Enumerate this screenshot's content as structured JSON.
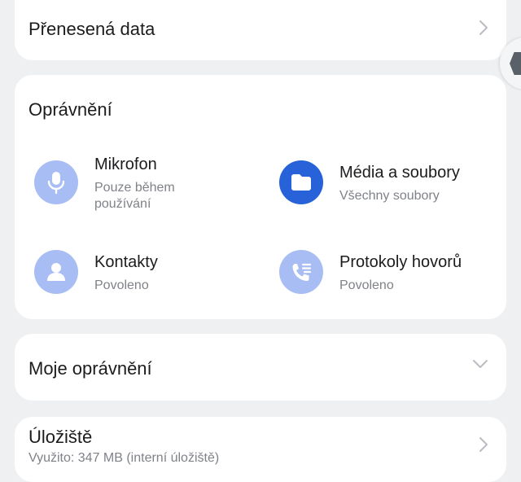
{
  "transferred": {
    "label": "Přenesená data"
  },
  "permissions": {
    "title": "Oprávnění",
    "items": [
      {
        "name": "Mikrofon",
        "status": "Pouze během používání",
        "icon": "microphone-icon",
        "color": "#a8bdf3"
      },
      {
        "name": "Média a soubory",
        "status": "Všechny soubory",
        "icon": "folder-icon",
        "color": "#2762d9"
      },
      {
        "name": "Kontakty",
        "status": "Povoleno",
        "icon": "contacts-icon",
        "color": "#a8bdf3"
      },
      {
        "name": "Protokoly hovorů",
        "status": "Povoleno",
        "icon": "call-log-icon",
        "color": "#a8bdf3"
      }
    ]
  },
  "my_permissions": {
    "label": "Moje oprávnění"
  },
  "storage": {
    "label": "Úložiště",
    "subtitle": "Využito: 347 MB (interní úložiště)"
  }
}
